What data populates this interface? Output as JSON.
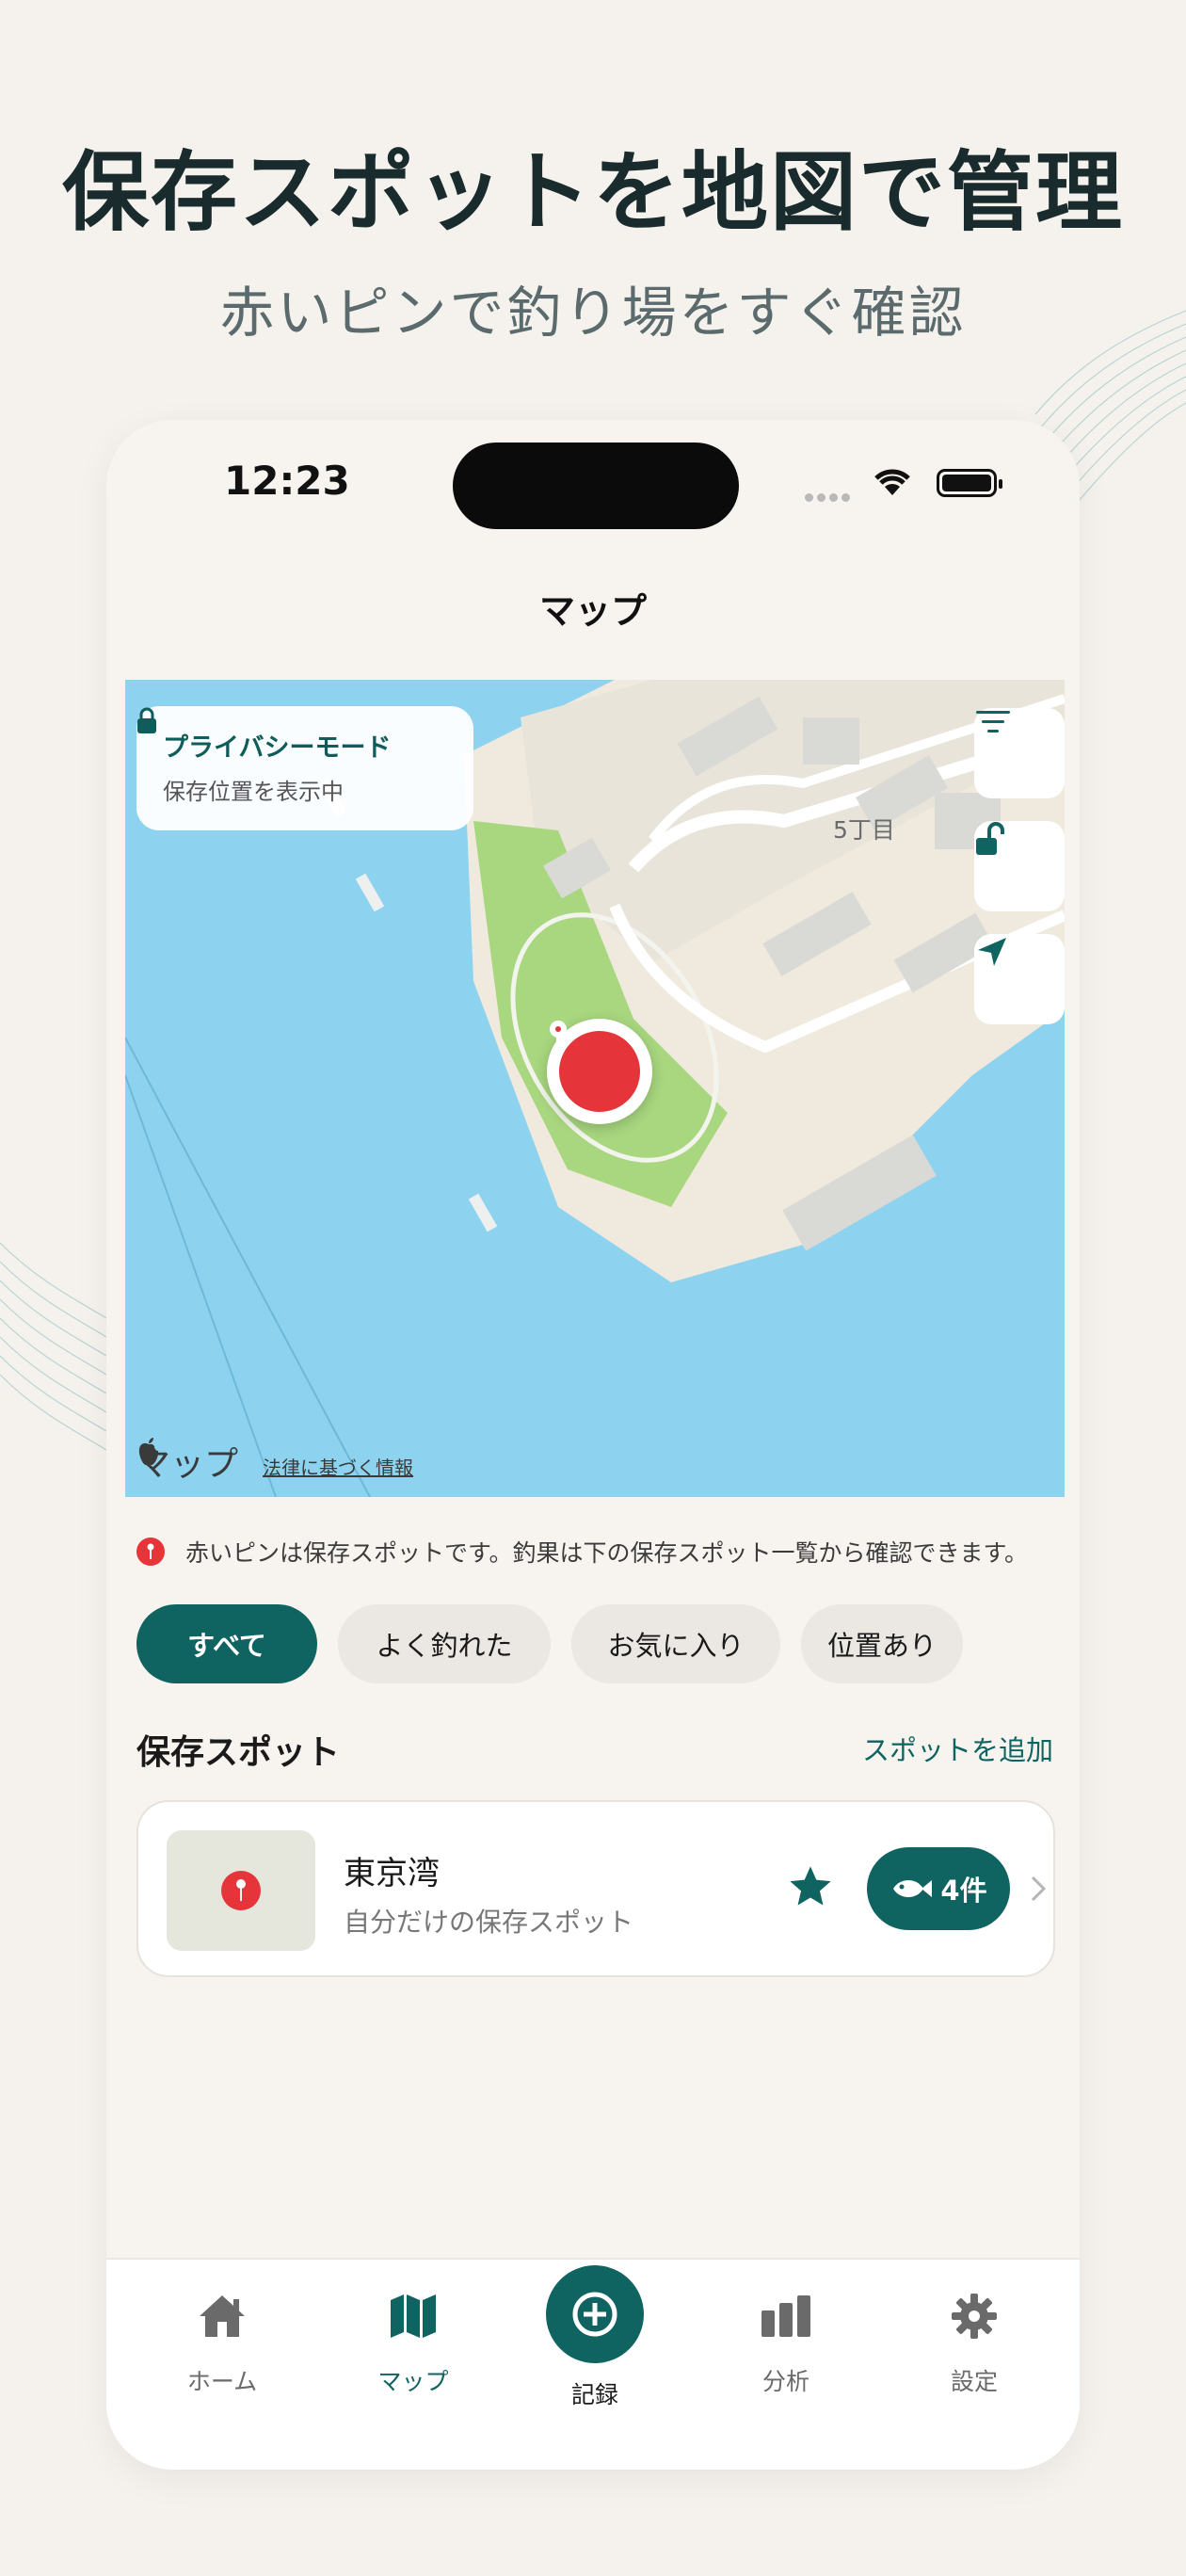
{
  "promo": {
    "headline": "保存スポットを地図で管理",
    "subheadline": "赤いピンで釣り場をすぐ確認"
  },
  "status_bar": {
    "time": "12:23"
  },
  "nav": {
    "title": "マップ"
  },
  "map": {
    "privacy_title": "プライバシーモード",
    "privacy_subtitle": "保存位置を表示中",
    "area_label": "5丁目",
    "attribution": "マップ",
    "legal_link": "法律に基づく情報",
    "controls": [
      "list-filter-icon",
      "unlock-icon",
      "location-arrow-icon"
    ]
  },
  "notice": {
    "text": "赤いピンは保存スポットです。釣果は下の保存スポット一覧から確認できます。"
  },
  "filters": [
    {
      "label": "すべて",
      "active": true
    },
    {
      "label": "よく釣れた",
      "active": false
    },
    {
      "label": "お気に入り",
      "active": false
    },
    {
      "label": "位置あり",
      "active": false
    }
  ],
  "spots_section": {
    "title": "保存スポット",
    "add_link": "スポットを追加"
  },
  "spot": {
    "name": "東京湾",
    "description": "自分だけの保存スポット",
    "count": "4件",
    "favorite": true
  },
  "tabbar": {
    "items": [
      {
        "label": "ホーム",
        "icon": "home-icon"
      },
      {
        "label": "マップ",
        "icon": "map-icon",
        "active": true
      },
      {
        "label": "記録",
        "icon": "plus-icon"
      },
      {
        "label": "分析",
        "icon": "bar-chart-icon"
      },
      {
        "label": "設定",
        "icon": "gear-icon"
      }
    ]
  },
  "colors": {
    "accent": "#0f6360",
    "pin": "#e5343a",
    "water": "#8dd3ef",
    "background": "#f5f2ed"
  }
}
